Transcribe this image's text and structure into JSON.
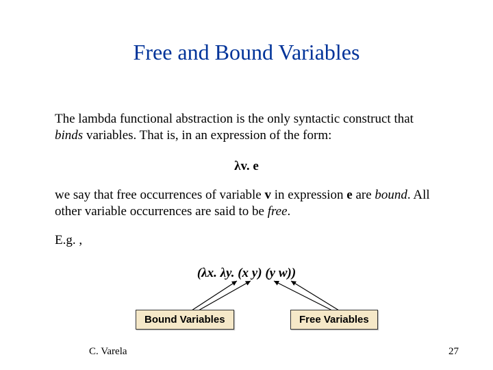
{
  "title": "Free and Bound Variables",
  "para1_a": "The lambda functional abstraction is the only syntactic construct that ",
  "para1_binds": "binds",
  "para1_b": " variables.  That is, in an expression of the form:",
  "lambda_expr": "λv. e",
  "para2_a": "we say that free occurrences of variable ",
  "para2_v": "v",
  "para2_b": " in expression ",
  "para2_e": "e",
  "para2_c": " are ",
  "para2_bound": "bound",
  "para2_d": ". All other variable occurrences are said to be ",
  "para2_free": "free",
  "para2_e2": ".",
  "eg": "E.g. ,",
  "example_expr": "(λx. λy. (x y) (y w))",
  "bound_label": "Bound Variables",
  "free_label": "Free Variables",
  "footer_author": "C. Varela",
  "footer_page": "27"
}
